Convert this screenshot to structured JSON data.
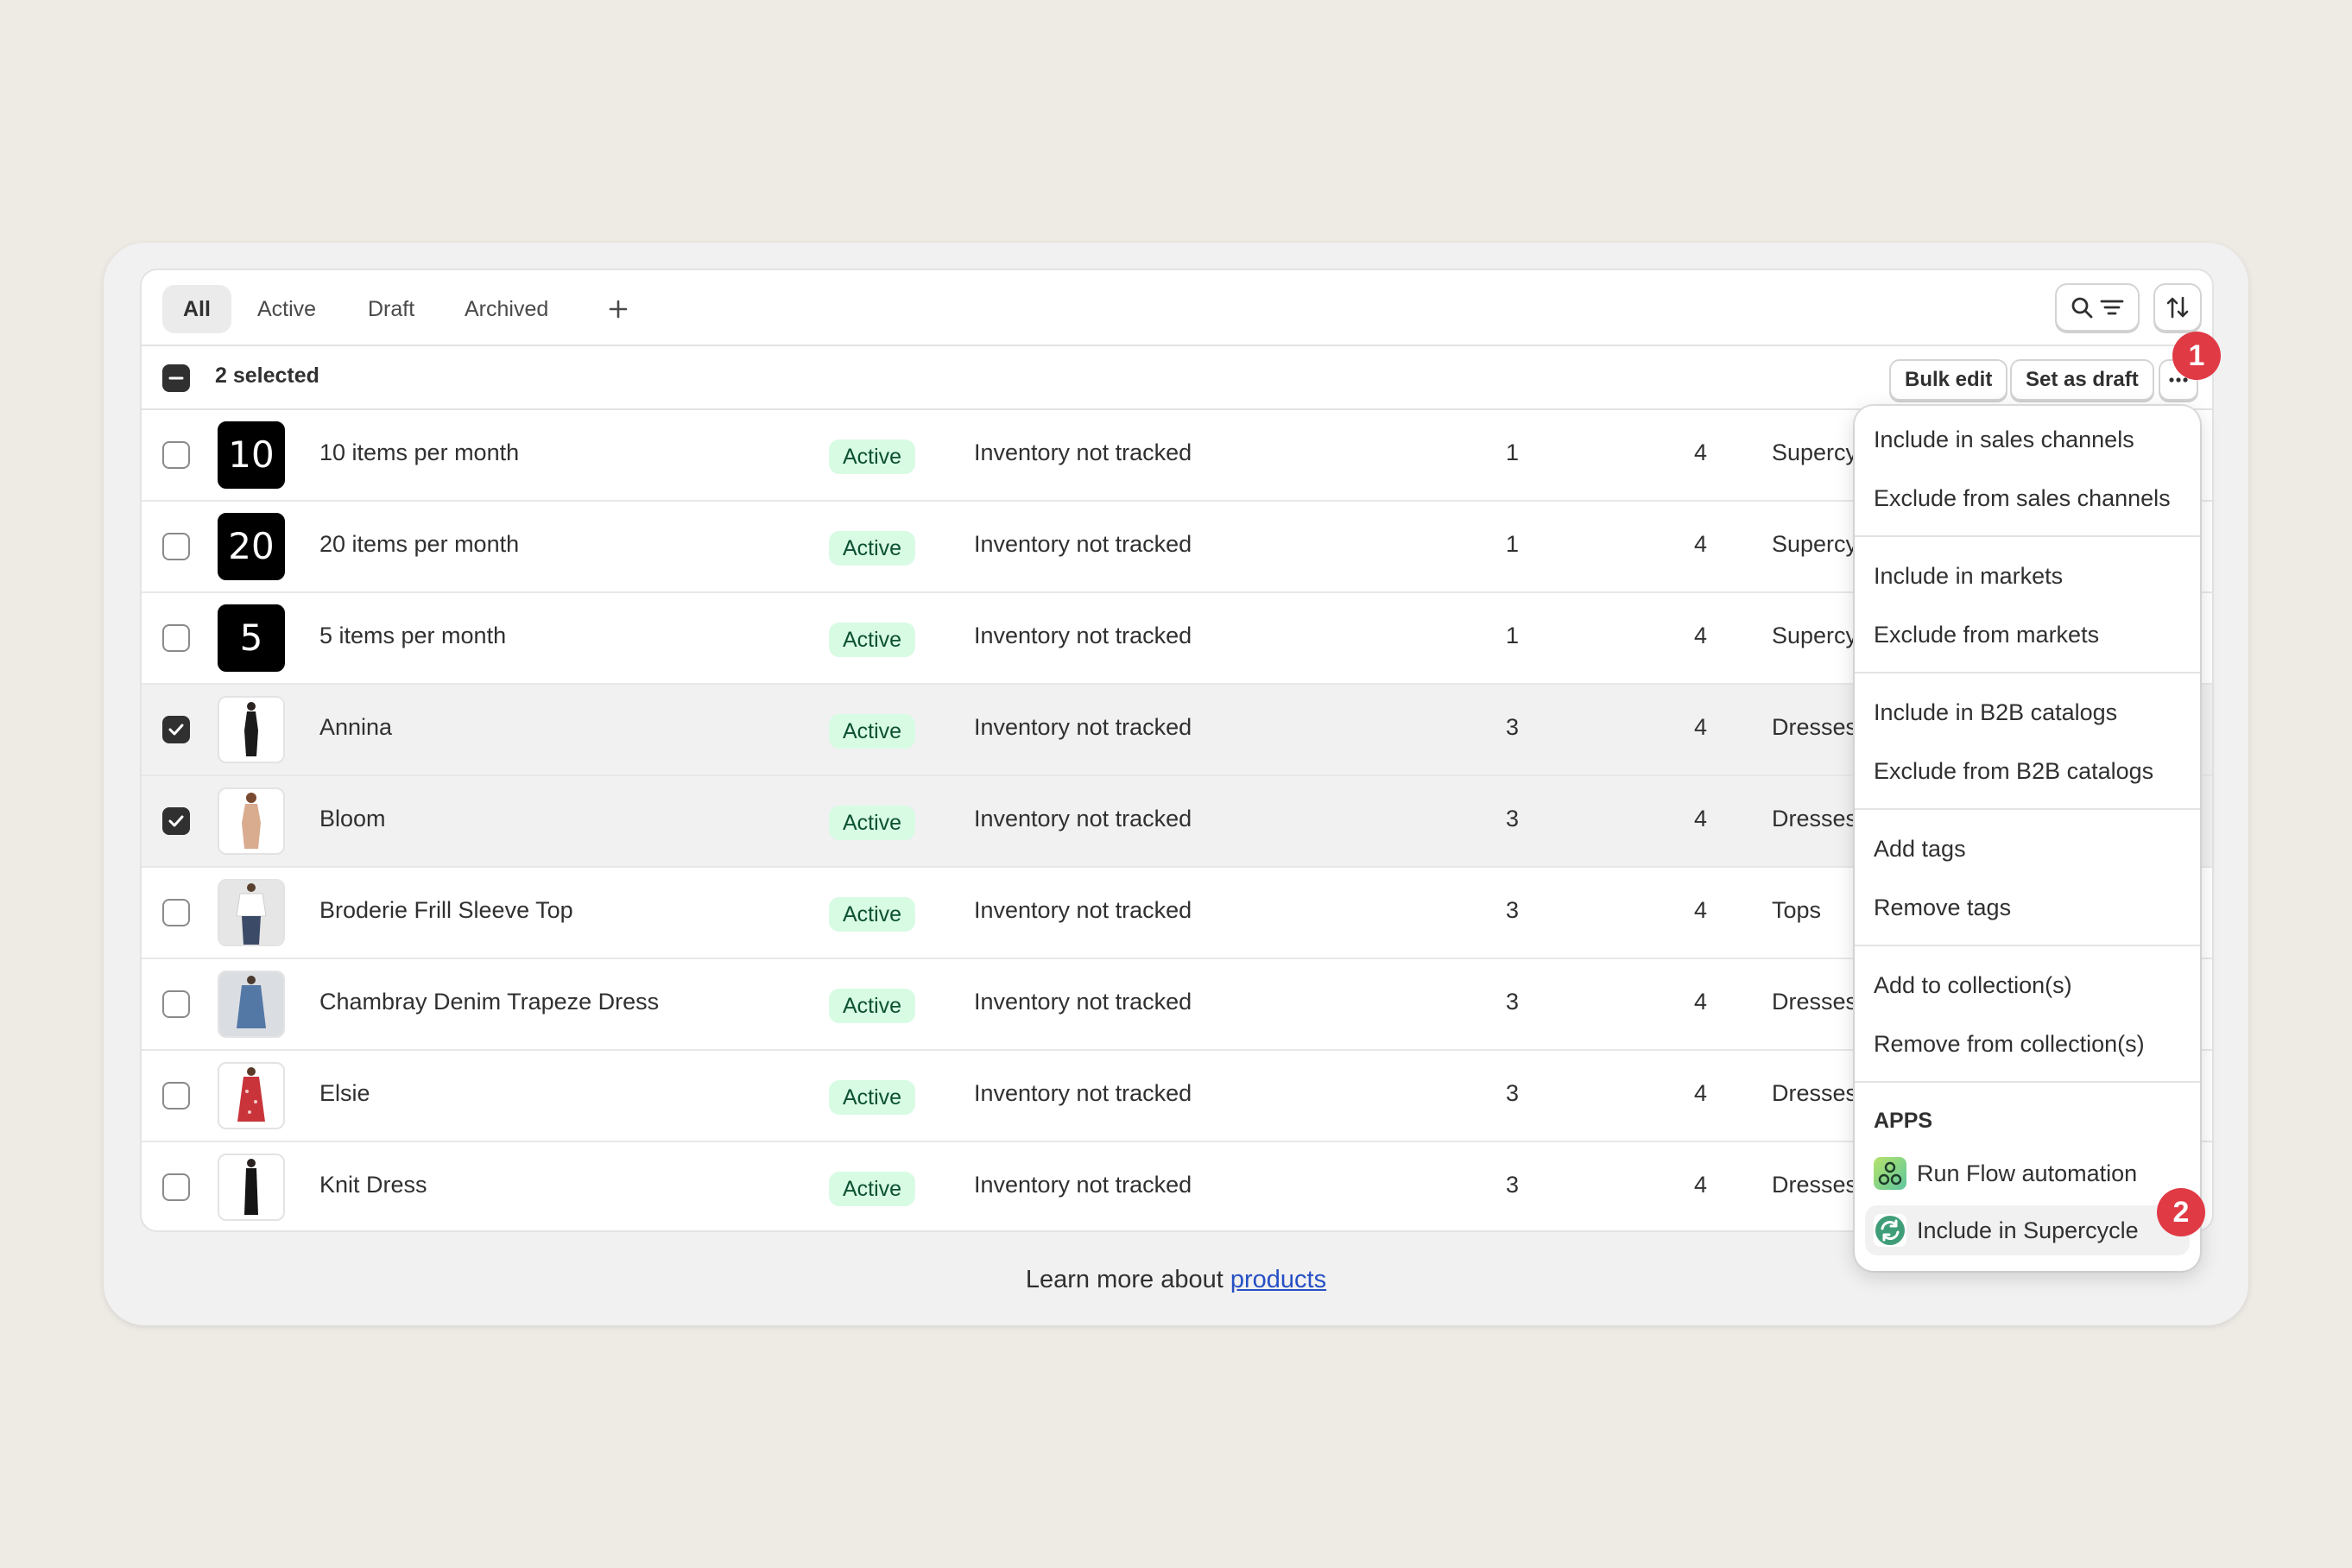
{
  "tabs": [
    {
      "label": "All",
      "active": true
    },
    {
      "label": "Active"
    },
    {
      "label": "Draft"
    },
    {
      "label": "Archived"
    }
  ],
  "add_tab_icon": "plus-icon",
  "toolbar": {
    "search_filter_icons": [
      "search-icon",
      "filter-icon"
    ],
    "sort_icon": "sort-icon"
  },
  "bulk": {
    "selected_text": "2 selected",
    "bulk_edit": "Bulk edit",
    "set_as_draft": "Set as draft",
    "more_icon": "ellipsis-icon"
  },
  "products": [
    {
      "name": "10 items per month",
      "thumb_text": "10",
      "status": "Active",
      "inventory": "Inventory not tracked",
      "col_a": "1",
      "col_b": "4",
      "type": "Supercy",
      "selected": false
    },
    {
      "name": "20 items per month",
      "thumb_text": "20",
      "status": "Active",
      "inventory": "Inventory not tracked",
      "col_a": "1",
      "col_b": "4",
      "type": "Supercy",
      "selected": false
    },
    {
      "name": "5 items per month",
      "thumb_text": "5",
      "status": "Active",
      "inventory": "Inventory not tracked",
      "col_a": "1",
      "col_b": "4",
      "type": "Supercy",
      "selected": false
    },
    {
      "name": "Annina",
      "thumb_text": "",
      "status": "Active",
      "inventory": "Inventory not tracked",
      "col_a": "3",
      "col_b": "4",
      "type": "Dresses",
      "selected": true
    },
    {
      "name": "Bloom",
      "thumb_text": "",
      "status": "Active",
      "inventory": "Inventory not tracked",
      "col_a": "3",
      "col_b": "4",
      "type": "Dresses",
      "selected": true
    },
    {
      "name": "Broderie Frill Sleeve Top",
      "thumb_text": "",
      "status": "Active",
      "inventory": "Inventory not tracked",
      "col_a": "3",
      "col_b": "4",
      "type": "Tops",
      "selected": false
    },
    {
      "name": "Chambray Denim Trapeze Dress",
      "thumb_text": "",
      "status": "Active",
      "inventory": "Inventory not tracked",
      "col_a": "3",
      "col_b": "4",
      "type": "Dresses",
      "selected": false
    },
    {
      "name": "Elsie",
      "thumb_text": "",
      "status": "Active",
      "inventory": "Inventory not tracked",
      "col_a": "3",
      "col_b": "4",
      "type": "Dresses",
      "selected": false
    },
    {
      "name": "Knit Dress",
      "thumb_text": "",
      "status": "Active",
      "inventory": "Inventory not tracked",
      "col_a": "3",
      "col_b": "4",
      "type": "Dresses",
      "selected": false
    }
  ],
  "menu": {
    "items": [
      "Include in sales channels",
      "Exclude from sales channels",
      "Include in markets",
      "Exclude from markets",
      "Include in B2B catalogs",
      "Exclude from B2B catalogs",
      "Add tags",
      "Remove tags",
      "Add to collection(s)",
      "Remove from collection(s)"
    ],
    "apps_heading": "APPS",
    "apps": [
      {
        "label": "Run Flow automation",
        "icon": "flow-app-icon"
      },
      {
        "label": "Include in Supercycle",
        "icon": "supercycle-app-icon"
      }
    ]
  },
  "footer": {
    "prefix": "Learn more about ",
    "link": "products"
  },
  "markers": [
    "1",
    "2"
  ],
  "colors": {
    "badge_bg": "#d8fbe4",
    "badge_text": "#0c5132",
    "marker": "#e03a45",
    "link": "#2650c5"
  }
}
